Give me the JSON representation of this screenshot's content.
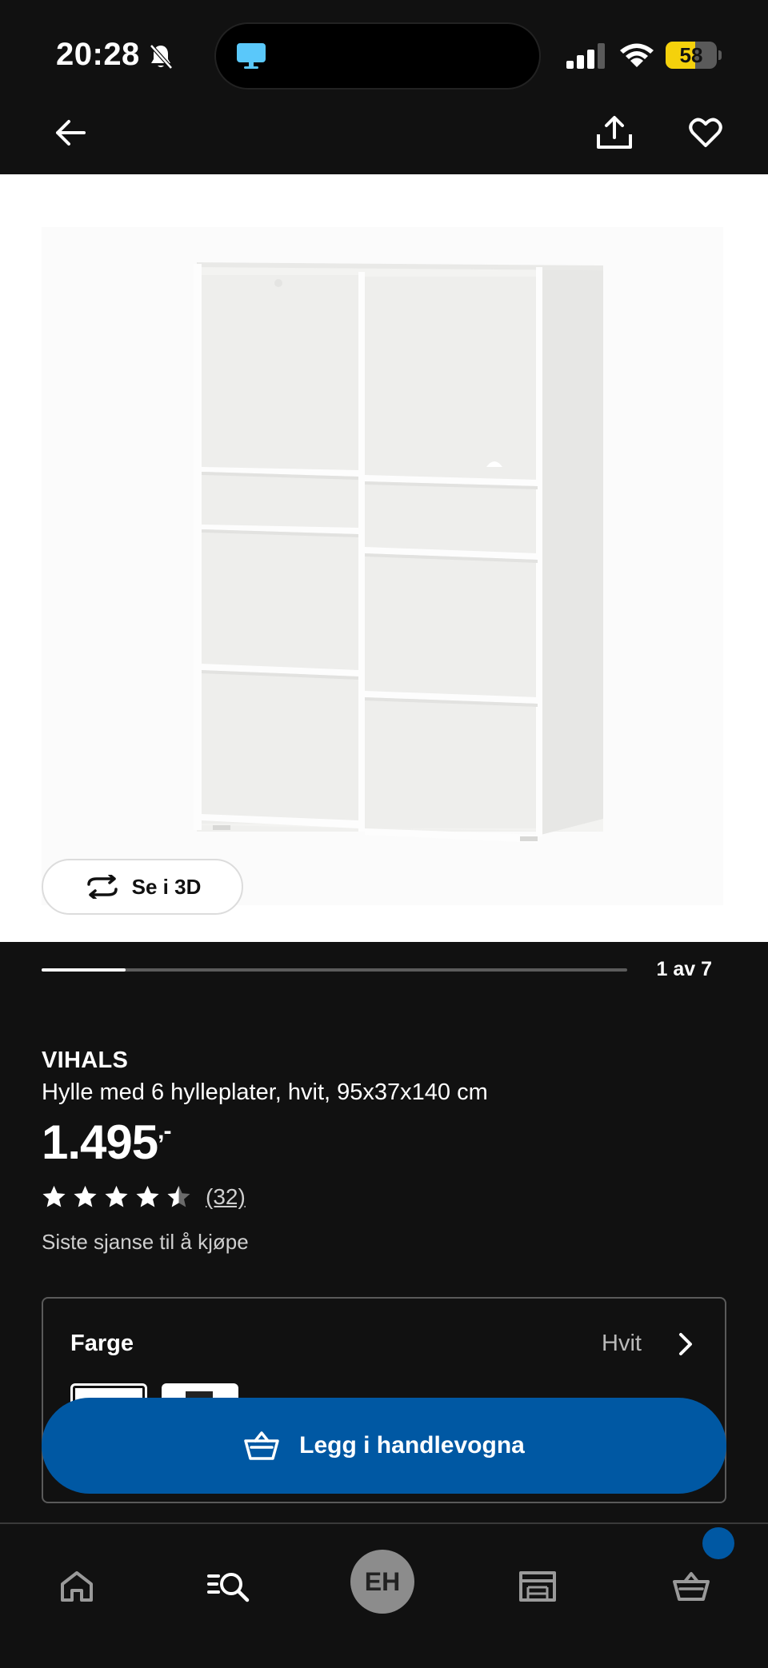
{
  "status_bar": {
    "time": "20:28",
    "battery_level": "58",
    "battery_fraction": 0.58,
    "accent_battery": "#f5d10c",
    "icons": [
      "bell-slash-icon",
      "screen-icon",
      "signal-icon",
      "wifi-icon",
      "battery-icon"
    ]
  },
  "header": {
    "icons": [
      "arrow-left-icon",
      "share-icon",
      "heart-icon"
    ]
  },
  "gallery": {
    "view_3d_label": "Se i 3D",
    "counter": "1 av 7",
    "progress_fraction": 0.143
  },
  "product": {
    "name": "VIHALS",
    "description": "Hylle med 6 hylleplater, hvit, 95x37x140 cm",
    "price": "1.495",
    "price_suffix": ",-",
    "rating": 4.5,
    "rating_max": 5,
    "review_count": "(32)",
    "availability": "Siste sjanse til å kjøpe"
  },
  "color_selector": {
    "label": "Farge",
    "value": "Hvit"
  },
  "cart_button": {
    "label": "Legg i handlevogna",
    "color": "#0058a3"
  },
  "bottom_nav": {
    "profile_initials": "EH",
    "items": [
      "home-icon",
      "search-list-icon",
      "profile-avatar",
      "store-icon",
      "cart-icon"
    ]
  }
}
